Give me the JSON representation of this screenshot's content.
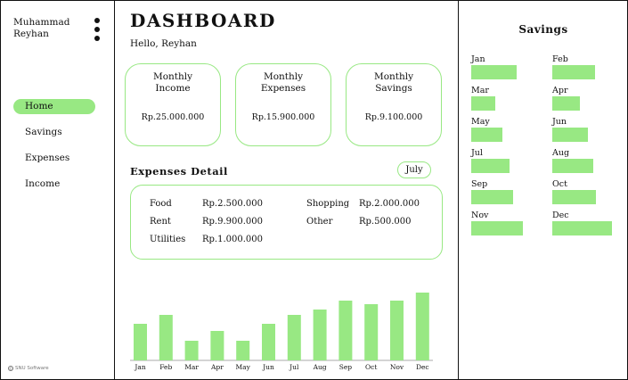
{
  "sidebar": {
    "user_name": "Muhammad Reyhan",
    "nav": [
      {
        "label": "Home",
        "active": true
      },
      {
        "label": "Savings",
        "active": false
      },
      {
        "label": "Expenses",
        "active": false
      },
      {
        "label": "Income",
        "active": false
      }
    ],
    "footer": "SNU Software",
    "menu_icon": "kebab-menu-icon"
  },
  "main": {
    "title": "DASHBOARD",
    "greeting": "Hello, Reyhan",
    "cards": [
      {
        "title": "Monthly Income",
        "value": "Rp.25.000.000"
      },
      {
        "title": "Monthly Expenses",
        "value": "Rp.15.900.000"
      },
      {
        "title": "Monthly Savings",
        "value": "Rp.9.100.000"
      }
    ],
    "expenses_title": "Expenses Detail",
    "month": "July",
    "expenses": [
      {
        "label": "Food",
        "value": "Rp.2.500.000"
      },
      {
        "label": "Rent",
        "value": "Rp.9.900.000"
      },
      {
        "label": "Utilities",
        "value": "Rp.1.000.000"
      },
      {
        "label": "Shopping",
        "value": "Rp.2.000.000"
      },
      {
        "label": "Other",
        "value": "Rp.500.000"
      }
    ]
  },
  "chart_data": {
    "type": "bar",
    "categories": [
      "Jan",
      "Feb",
      "Mar",
      "Apr",
      "May",
      "Jun",
      "Jul",
      "Aug",
      "Sep",
      "Oct",
      "Nov",
      "Dec"
    ],
    "values": [
      41,
      51,
      22,
      33,
      22,
      41,
      51,
      57,
      67,
      63,
      67,
      76
    ],
    "ylim": [
      0,
      80
    ],
    "color": "#98e883"
  },
  "savings": {
    "title": "Savings",
    "months": [
      "Jan",
      "Feb",
      "Mar",
      "Apr",
      "May",
      "Jun",
      "Jul",
      "Aug",
      "Sep",
      "Oct",
      "Nov",
      "Dec"
    ],
    "levels": [
      0.6,
      0.57,
      0.32,
      0.36,
      0.41,
      0.47,
      0.51,
      0.54,
      0.55,
      0.58,
      0.68,
      0.79
    ],
    "color": "#98e883"
  }
}
